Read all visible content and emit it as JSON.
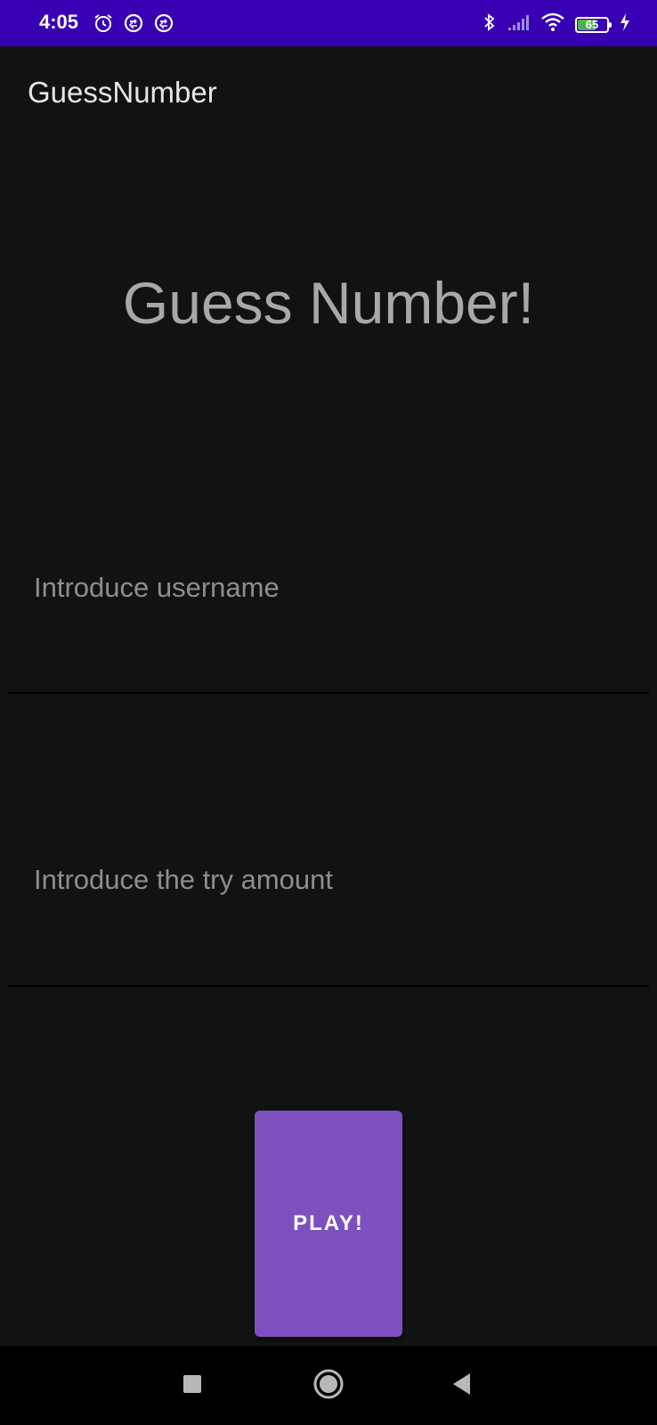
{
  "status_bar": {
    "time": "4:05",
    "battery_level": "65",
    "battery_fraction": 0.65,
    "left_icons": [
      "alarm-icon",
      "sync-icon",
      "sync-icon"
    ],
    "right_icons": [
      "bluetooth-icon",
      "signal-icon",
      "wifi-icon",
      "battery-icon",
      "charging-icon"
    ],
    "background_color": "#3700B3"
  },
  "app_bar": {
    "title": "GuessNumber"
  },
  "main": {
    "heading": "Guess Number!",
    "username_field": {
      "placeholder": "Introduce username",
      "value": ""
    },
    "tries_field": {
      "placeholder": "Introduce the try amount",
      "value": ""
    },
    "play_button": {
      "label": "PLAY!",
      "color": "#7E50BF"
    }
  },
  "nav_bar": {
    "buttons": [
      "recents-icon",
      "home-icon",
      "back-icon"
    ]
  }
}
